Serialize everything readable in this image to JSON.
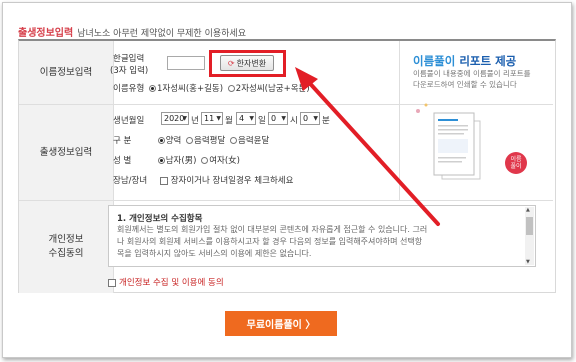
{
  "header": {
    "title": "출생정보입력",
    "note": "남녀노소 아무런 제약없이 무제한 이용하세요"
  },
  "name_section": {
    "label": "이름정보입력",
    "hangul_label_1": "한글입력",
    "hangul_label_2": "(3자 입력)",
    "hangul_value": "",
    "hanja_button": "한자변환",
    "name_type_label": "이름유형",
    "name_type_opt1": "1자성씨(홍+길동)",
    "name_type_opt2": "2자성씨(남궁+옥분)"
  },
  "birth_section": {
    "label": "출생정보입력",
    "birth_label": "생년월일",
    "year": "2020",
    "year_unit": "년",
    "month": "11",
    "month_unit": "월",
    "day": "4",
    "day_unit": "일",
    "hour": "0",
    "hour_unit": "시",
    "minute": "0",
    "minute_unit": "분",
    "calendar_label": "구  분",
    "cal_opt1": "양력",
    "cal_opt2": "음력평달",
    "cal_opt3": "음력윤달",
    "gender_label": "성  별",
    "gender_opt1": "남자(男)",
    "gender_opt2": "여자(女)",
    "disability_label": "장남/장녀",
    "disability_text": "장자이거나 장녀일경우 체크하세요"
  },
  "promo": {
    "title_a": "이름풀이",
    "title_b": "리포트 제공",
    "desc_1": "이름풀이 내용중에 이름풀이 리포트를",
    "desc_2": "다운로드하여 인쇄할 수 있습니다",
    "badge": "이름풀이"
  },
  "privacy_section": {
    "label_1": "개인정보",
    "label_2": "수집동의",
    "box_title": "1. 개인정보의 수집항목",
    "box_line_1": "회원께서는 별도의 회원가입 절차 없이 대부분의 콘텐츠에 자유롭게 접근할 수 있습니다. 그러",
    "box_line_2": "나 회원사의 회원제 서비스를 이용하시고자 할 경우 다음의 정보를 입력해주셔야하며 선택항",
    "box_line_3": "목을 입력하시지 않아도 서비스의 이용에 제한은 없습니다.",
    "agree_text": "개인정보 수집 및 이용에 동의"
  },
  "submit_label": "무료이름풀이 〉",
  "colors": {
    "accent_red": "#e21e26",
    "submit": "#ef6a1f",
    "promo_blue": "#2d8fd6"
  }
}
